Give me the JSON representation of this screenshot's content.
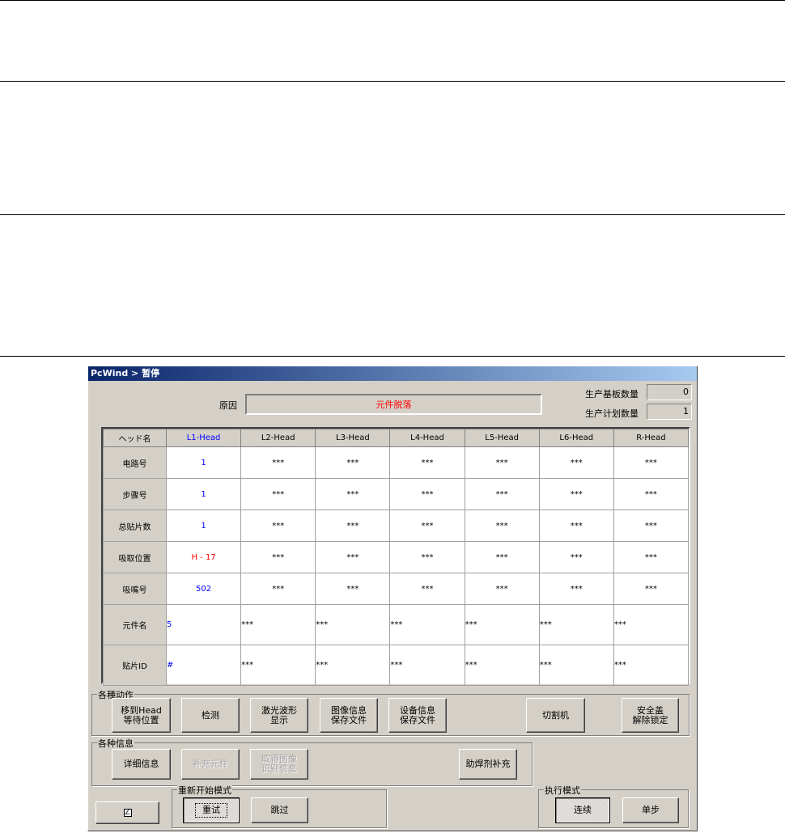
{
  "window": {
    "title": "PcWind > 暂停"
  },
  "reason": {
    "label": "原因",
    "value": "元件脱落"
  },
  "counters": [
    {
      "label": "生产基板数量",
      "value": "0"
    },
    {
      "label": "生产计划数量",
      "value": "1"
    }
  ],
  "grid": {
    "header_label": "ヘッド名",
    "columns": [
      "L1-Head",
      "L2-Head",
      "L3-Head",
      "L4-Head",
      "L5-Head",
      "L6-Head",
      "R-Head"
    ],
    "rows": [
      {
        "label": "电路号",
        "values": [
          "1",
          "***",
          "***",
          "***",
          "***",
          "***",
          "***"
        ]
      },
      {
        "label": "步骤号",
        "values": [
          "1",
          "***",
          "***",
          "***",
          "***",
          "***",
          "***"
        ]
      },
      {
        "label": "总贴片数",
        "values": [
          "1",
          "***",
          "***",
          "***",
          "***",
          "***",
          "***"
        ]
      },
      {
        "label": "吸取位置",
        "values": [
          "H - 17",
          "***",
          "***",
          "***",
          "***",
          "***",
          "***"
        ]
      },
      {
        "label": "吸嘴号",
        "values": [
          "502",
          "***",
          "***",
          "***",
          "***",
          "***",
          "***"
        ]
      },
      {
        "label": "元件名",
        "values": [
          "5",
          "***",
          "***",
          "***",
          "***",
          "***",
          "***"
        ]
      },
      {
        "label": "贴片ID",
        "values": [
          "#",
          "***",
          "***",
          "***",
          "***",
          "***",
          "***"
        ]
      }
    ]
  },
  "actions": {
    "caption": "各種动作",
    "buttons": [
      "移到Head\n等待位置",
      "检测",
      "激光波形\n显示",
      "图像信息\n保存文件",
      "设备信息\n保存文件",
      "切割机",
      "安全盖\n解除锁定"
    ]
  },
  "info": {
    "caption": "各种信息",
    "buttons": [
      "详细信息",
      "补充元件",
      "取得图像\n识别信息",
      "助焊剂补充"
    ]
  },
  "restart": {
    "caption": "重新开始模式",
    "buttons": [
      "重试",
      "跳过"
    ]
  },
  "exec": {
    "caption": "执行模式",
    "buttons": [
      "连续",
      "单步"
    ]
  },
  "small_button": {
    "icon": "edit-icon"
  },
  "colors": {
    "title_start": "#0a246a",
    "title_end": "#a6caf0",
    "reason": "#ff0000",
    "l1": "#0000ff"
  }
}
